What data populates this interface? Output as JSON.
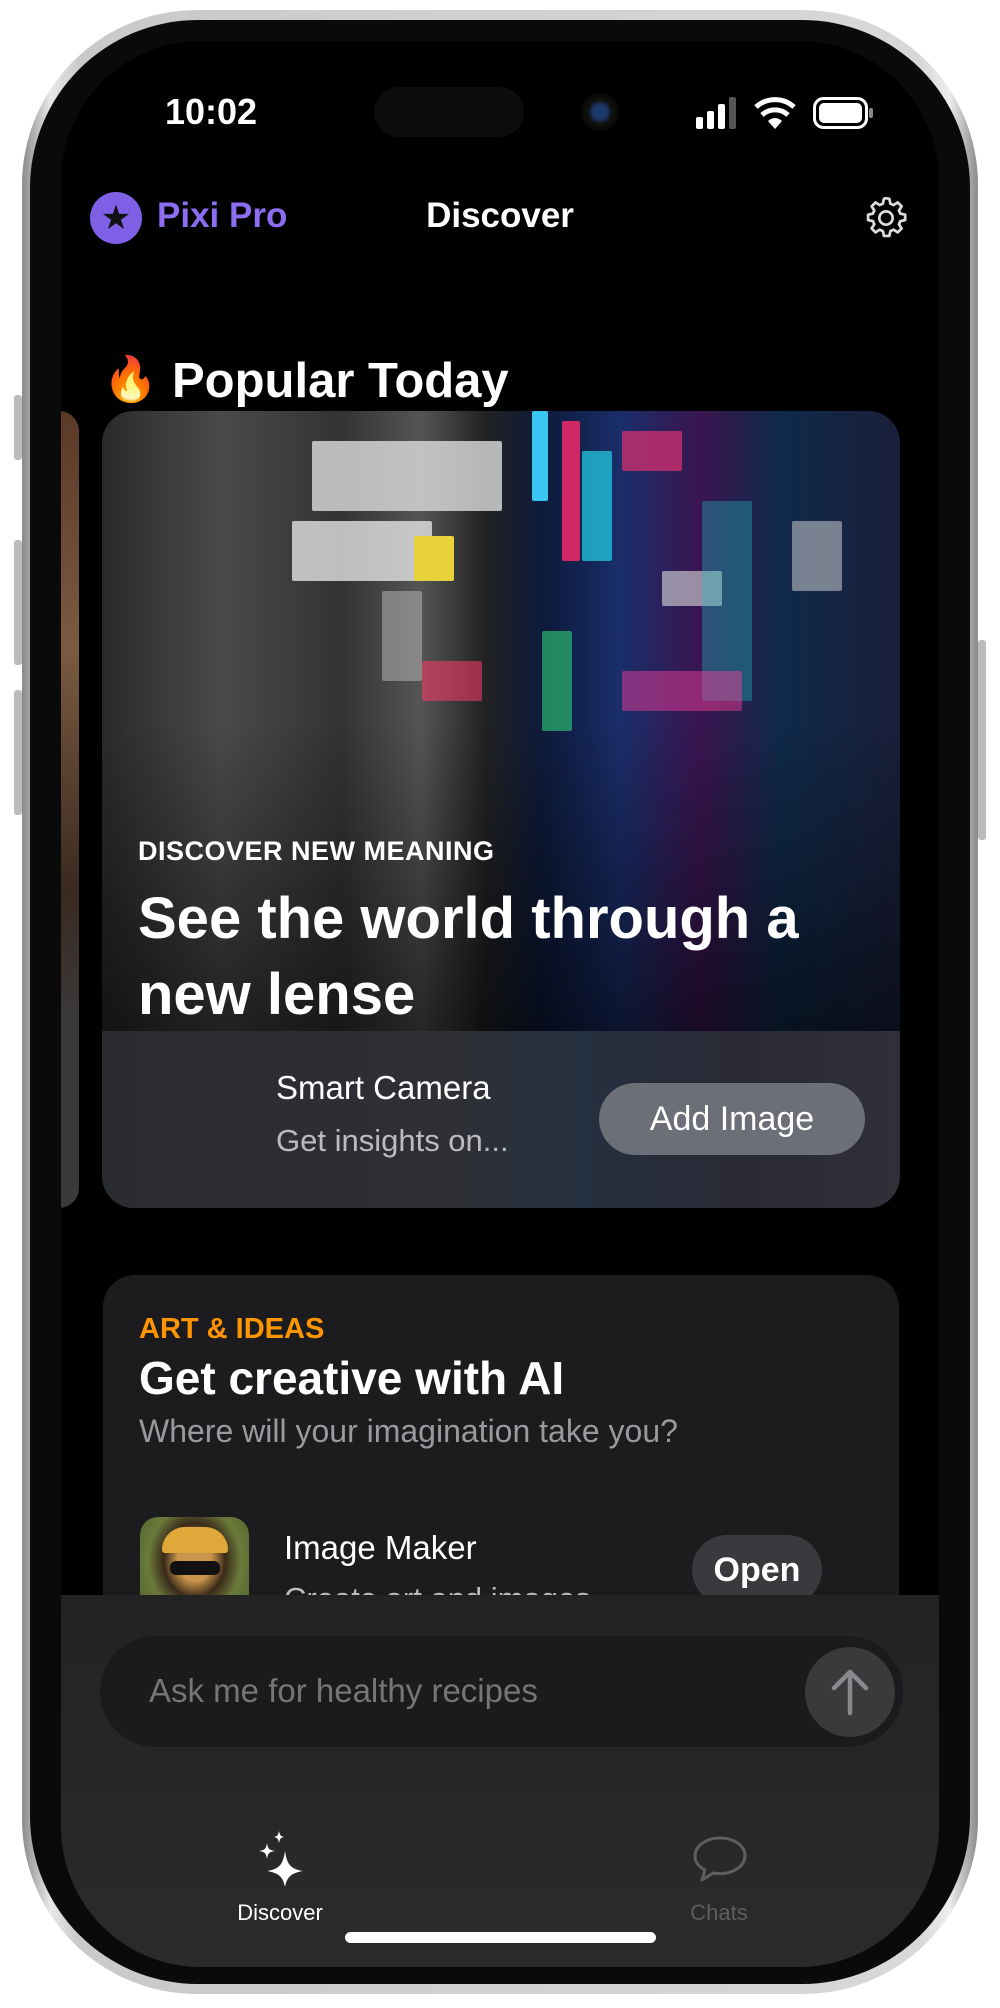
{
  "status_bar": {
    "time": "10:02",
    "icons": [
      "cellular-signal-icon",
      "wifi-icon",
      "battery-icon"
    ]
  },
  "header": {
    "brand": "Pixi Pro",
    "brand_icon": "star-icon",
    "title": "Discover",
    "settings_icon": "gear-icon",
    "brand_color": "#8d6df2"
  },
  "section": {
    "emoji": "🔥",
    "title": "Popular Today"
  },
  "featured": {
    "kicker": "DISCOVER NEW MEANING",
    "headline": "See the world through a new lense",
    "app": {
      "title": "Smart Camera",
      "subtitle": "Get insights on...",
      "button": "Add Image"
    }
  },
  "card2": {
    "kicker": "ART & IDEAS",
    "kicker_color": "#ff9500",
    "title": "Get creative with AI",
    "subtitle": "Where will your imagination take you?",
    "app": {
      "title": "Image Maker",
      "subtitle": "Create art and images",
      "button": "Open"
    }
  },
  "composer": {
    "placeholder": "Ask me for healthy recipes",
    "send_icon": "arrow-up-icon"
  },
  "tabs": [
    {
      "label": "Discover",
      "icon": "sparkles-icon",
      "active": true
    },
    {
      "label": "Chats",
      "icon": "chat-bubble-icon",
      "active": false
    }
  ]
}
